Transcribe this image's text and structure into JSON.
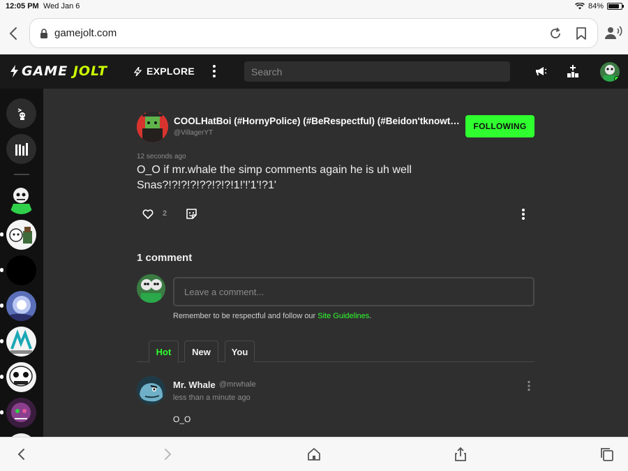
{
  "status_bar": {
    "time": "12:05 PM",
    "date": "Wed Jan 6",
    "battery": "84%",
    "battery_level": 0.84
  },
  "browser": {
    "url": "gamejolt.com"
  },
  "header": {
    "logo_text_game": "GAME",
    "logo_text_jolt": "JOLT",
    "explore_label": "EXPLORE",
    "search_placeholder": "Search"
  },
  "post": {
    "author_name": "COOLHatBoi (#HornyPolice) (#BeRespectful) (#Beidon'tknowthi...",
    "author_handle": "@VillagerYT",
    "follow_label": "FOLLOWING",
    "time": "12 seconds ago",
    "body": "O_O if mr.whale the simp comments again he is uh well Snas?!?!?!?!??!?!?!1!'!'1'!?1'",
    "like_count": "2"
  },
  "comments": {
    "title": "1 comment",
    "input_placeholder": "Leave a comment...",
    "guidelines_text": "Remember to be respectful and follow our ",
    "guidelines_link": "Site Guidelines",
    "guidelines_end": ".",
    "tabs": [
      {
        "label": "Hot",
        "active": true
      },
      {
        "label": "New",
        "active": false
      },
      {
        "label": "You",
        "active": false
      }
    ],
    "items": [
      {
        "name": "Mr. Whale",
        "handle": "@mrwhale",
        "time": "less than a minute ago",
        "body": "O_O"
      }
    ]
  },
  "colors": {
    "accent": "#2fff2f",
    "header_bg": "#191919",
    "content_bg": "#2f2f2f",
    "rail_bg": "#111111"
  }
}
